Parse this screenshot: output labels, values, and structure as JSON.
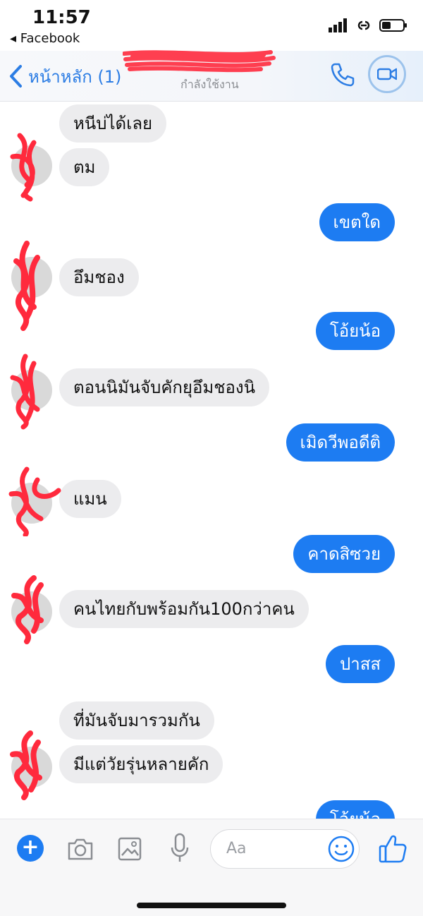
{
  "status_bar": {
    "time": "11:57",
    "back_app_label": "◂ Facebook",
    "icons": [
      "signal-icon",
      "link-icon",
      "battery-icon"
    ]
  },
  "header": {
    "back_label": "หน้าหลัก (1)",
    "contact_status": "กำลังใช้งาน",
    "icons": [
      "chevron-left-icon",
      "phone-icon",
      "video-camera-icon"
    ],
    "accent_color": "#2c7de4"
  },
  "messages": [
    {
      "side": "in",
      "text": "หนีบ่ได้เลย"
    },
    {
      "side": "in",
      "text": "ตม"
    },
    {
      "side": "out",
      "text": "เขตใด"
    },
    {
      "side": "in",
      "text": "อึมชอง"
    },
    {
      "side": "out",
      "text": "โอ้ยน้อ"
    },
    {
      "side": "in",
      "text": "ตอนนิมันจับคักยุอึมชองนิ"
    },
    {
      "side": "out",
      "text": "เมิดวีพอดีติ"
    },
    {
      "side": "in",
      "text": "แมน"
    },
    {
      "side": "out",
      "text": "คาดสิซวย"
    },
    {
      "side": "in",
      "text": "คนไทยกับพร้อมกัน100กว่าคน"
    },
    {
      "side": "out",
      "text": "ปาสส"
    },
    {
      "side": "in",
      "text": "ที่มันจับมารวมกัน"
    },
    {
      "side": "in",
      "text": "มีแต่วัยรุ่นหลายคัก"
    },
    {
      "side": "out",
      "text": "โอ้ยน้อ"
    }
  ],
  "composer": {
    "placeholder": "Aa",
    "icons": [
      "plus-icon",
      "camera-icon",
      "image-icon",
      "microphone-icon",
      "emoji-icon",
      "thumbs-up-icon"
    ],
    "accent_color": "#1d7cf2"
  },
  "colors": {
    "incoming_bubble": "#ececee",
    "outgoing_bubble": "#1d7cf2",
    "redaction": "#ff2a3d"
  }
}
